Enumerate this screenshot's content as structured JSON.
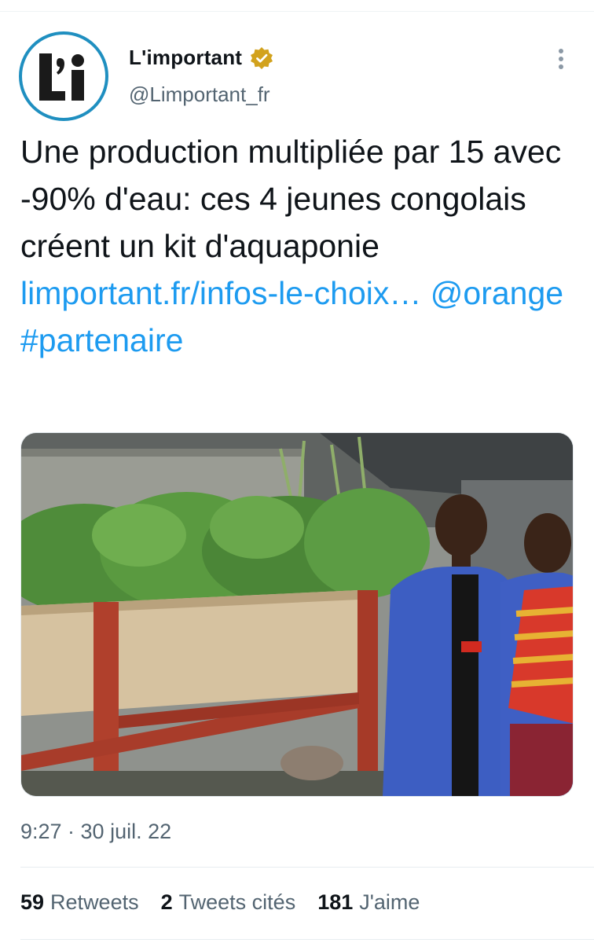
{
  "account": {
    "display_name": "L'important",
    "handle": "@Limportant_fr",
    "avatar_text": "L'i",
    "verified_icon": "verified-badge-icon",
    "accent_color": "#1f8fc0"
  },
  "tweet": {
    "text_plain": "Une production multipliée par 15 avec -90% d'eau: ces 4 jeunes congolais créent un kit d'aquaponie",
    "link": "limportant.fr/infos-le-choix…",
    "mention": "@orange",
    "hashtag": "#partenaire",
    "link_color": "#1d9bf0",
    "media": "photo-two-men-beside-aquaponics-planter"
  },
  "meta": {
    "timestamp": "9:27 · 30 juil. 22"
  },
  "stats": {
    "retweets_count": "59",
    "retweets_label": "Retweets",
    "quotes_count": "2",
    "quotes_label": "Tweets cités",
    "likes_count": "181",
    "likes_label": "J'aime"
  }
}
